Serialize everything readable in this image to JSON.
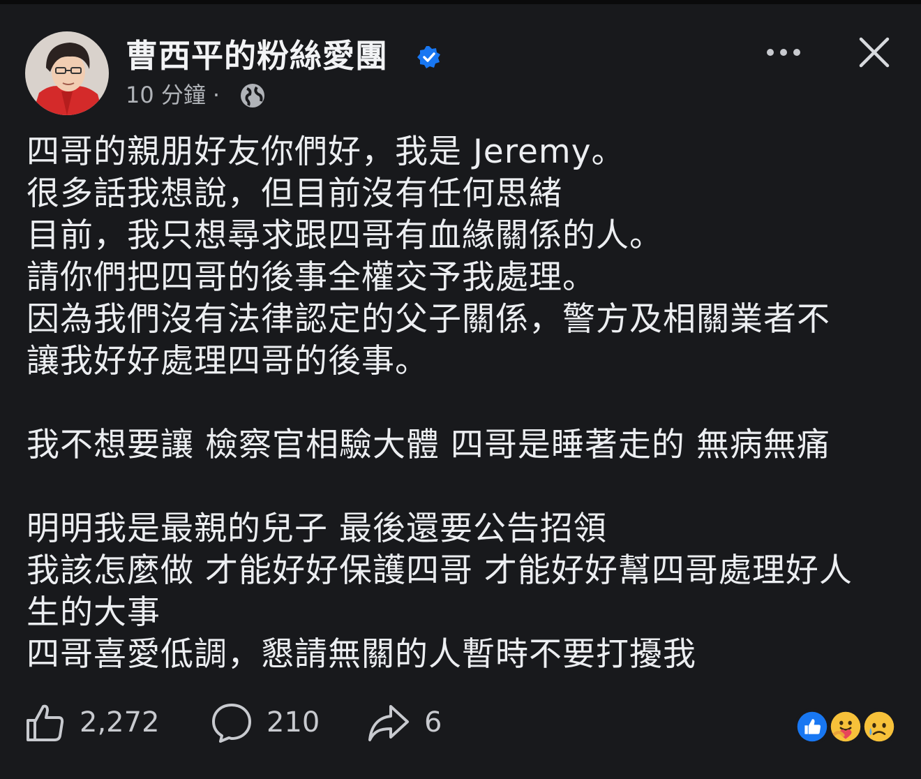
{
  "header": {
    "page_name": "曹西平的粉絲愛團",
    "timestamp": "10 分鐘",
    "separator": "·",
    "verified_icon": "verified-badge-icon",
    "privacy_icon": "globe-icon",
    "more_icon": "more-options-icon",
    "close_icon": "close-icon"
  },
  "post": {
    "lines": [
      "四哥的親朋好友你們好，我是 Jeremy。",
      "很多話我想說，但目前沒有任何思緒",
      "目前，我只想尋求跟四哥有血緣關係的人。",
      "請你們把四哥的後事全權交予我處理。",
      "因為我們沒有法律認定的父子關係，警方及相關業者不",
      "讓我好好處理四哥的後事。",
      "",
      "我不想要讓 檢察官相驗大體 四哥是睡著走的 無病無痛",
      "",
      "明明我是最親的兒子 最後還要公告招領",
      "我該怎麼做 才能好好保護四哥 才能好好幫四哥處理好人",
      "生的大事",
      "四哥喜愛低調，懇請無關的人暫時不要打擾我"
    ]
  },
  "footer": {
    "likes": "2,272",
    "comments": "210",
    "shares": "6",
    "like_icon": "thumbs-up-icon",
    "comment_icon": "comment-bubble-icon",
    "share_icon": "share-arrow-icon",
    "reaction_icons": [
      "like-reaction-icon",
      "care-reaction-icon",
      "sad-reaction-icon"
    ]
  },
  "colors": {
    "background": "#18191c",
    "text": "#eceef1",
    "muted": "#b0b3b8",
    "verified_blue": "#1877f2",
    "reaction_yellow": "#f7c13a"
  }
}
